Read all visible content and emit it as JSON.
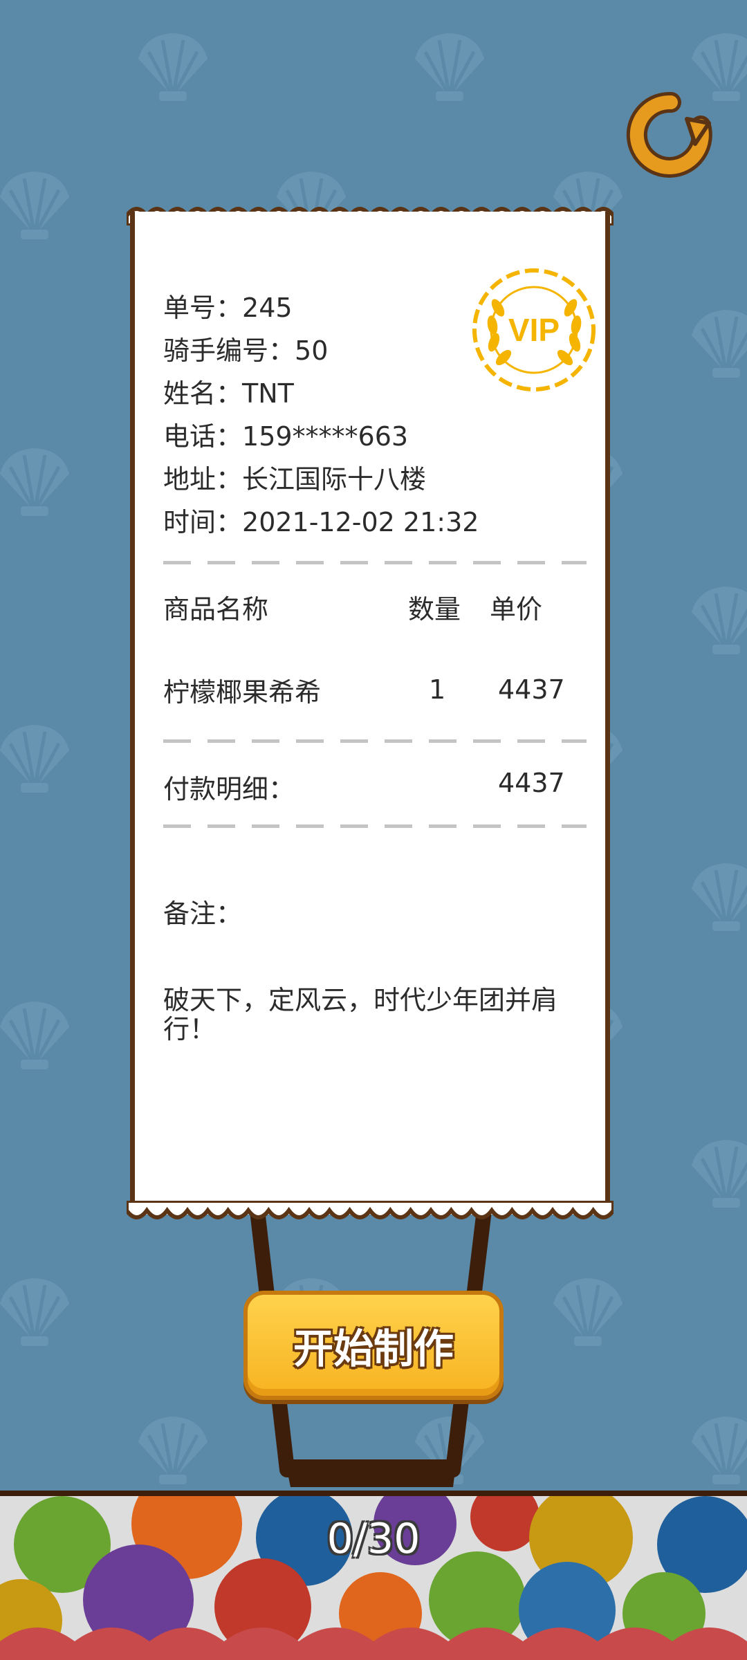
{
  "order": {
    "number_label": "单号：",
    "number": "245",
    "rider_label": "骑手编号：",
    "rider": "50",
    "name_label": "姓名：",
    "name": "TNT",
    "phone_label": "电话：",
    "phone": "159*****663",
    "address_label": "地址：",
    "address": "长江国际十八楼",
    "time_label": "时间：",
    "time": "2021-12-02 21:32"
  },
  "stamp_text": "VIP",
  "items_table": {
    "headers": [
      "商品名称",
      "数量",
      "单价"
    ],
    "rows": [
      {
        "name": "柠檬椰果希希",
        "qty": "1",
        "price": "4437"
      }
    ]
  },
  "payment": {
    "label": "付款明细：",
    "total": "4437"
  },
  "remark": {
    "label": "备注：",
    "text": "破天下，定风云，时代少年团并肩行！"
  },
  "start_button_label": "开始制作",
  "progress": "0/30",
  "colors": {
    "background": "#5a8aa8",
    "button": "#ffc83a",
    "receipt_border": "#5a3414",
    "stamp": "#f5b400"
  }
}
